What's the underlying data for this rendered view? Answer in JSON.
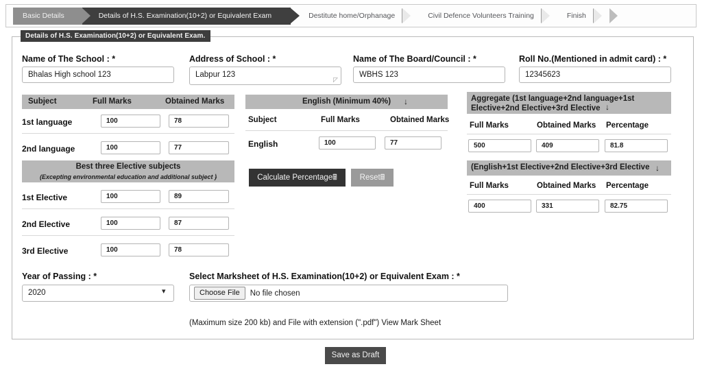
{
  "wizard": {
    "steps": [
      {
        "label": "Basic Details",
        "state": "done"
      },
      {
        "label": "Details of H.S. Examination(10+2) or Equivalent Exam",
        "state": "active"
      },
      {
        "label": "Destitute home/Orphanage",
        "state": "plain"
      },
      {
        "label": "Civil Defence Volunteers Training",
        "state": "plain"
      },
      {
        "label": "Finish",
        "state": "plain"
      }
    ]
  },
  "panel": {
    "legend": "Details of H.S. Examination(10+2) or Equivalent Exam."
  },
  "fields": {
    "school_name": {
      "label": "Name of The School : *",
      "value": "Bhalas High school 123"
    },
    "school_address": {
      "label": "Address of School : *",
      "value": "Labpur 123"
    },
    "board_name": {
      "label": "Name of The Board/Council : *",
      "value": "WBHS 123"
    },
    "roll_no": {
      "label": "Roll No.(Mentioned in admit card) : *",
      "value": "12345623"
    }
  },
  "language_table": {
    "headers": {
      "subject": "Subject",
      "full": "Full Marks",
      "obtained": "Obtained Marks"
    },
    "rows": [
      {
        "subject": "1st language",
        "full": "100",
        "obtained": "78"
      },
      {
        "subject": "2nd language",
        "full": "100",
        "obtained": "77"
      }
    ]
  },
  "elective_table": {
    "title": "Best three Elective subjects",
    "subtitle": "(Excepting environmental education and additional subject )",
    "arrow": "↓",
    "rows": [
      {
        "subject": "1st Elective",
        "full": "100",
        "obtained": "89"
      },
      {
        "subject": "2nd Elective",
        "full": "100",
        "obtained": "87"
      },
      {
        "subject": "3rd Elective",
        "full": "100",
        "obtained": "78"
      }
    ]
  },
  "english_table": {
    "title": "English (Minimum 40%)",
    "arrow": "↓",
    "headers": {
      "subject": "Subject",
      "full": "Full Marks",
      "obtained": "Obtained Marks"
    },
    "row": {
      "subject": "English",
      "full": "100",
      "obtained": "77"
    }
  },
  "actions": {
    "calculate_label": "Calculate Percentage",
    "calculate_icon": "὚9",
    "reset_label": "Reset",
    "reset_icon": "὚9",
    "save_label": "Save as Draft"
  },
  "aggregate": {
    "title": "Aggregate (1st language+2nd language+1st Elective+2nd Elective+3rd Elective",
    "arrow": "↓",
    "headers": {
      "full": "Full Marks",
      "obtained": "Obtained Marks",
      "percentage": "Percentage"
    },
    "full": "500",
    "obtained": "409",
    "percentage": "81.8"
  },
  "english_aggregate": {
    "title": "(English+1st Elective+2nd Elective+3rd Elective",
    "arrow": "↓",
    "headers": {
      "full": "Full Marks",
      "obtained": "Obtained Marks",
      "percentage": "Percentage"
    },
    "full": "400",
    "obtained": "331",
    "percentage": "82.75"
  },
  "year_of_passing": {
    "label": "Year of Passing : *",
    "value": "2020",
    "caret": "⌄"
  },
  "marksheet": {
    "label": "Select Marksheet of H.S. Examination(10+2) or Equivalent Exam : *",
    "choose_label": "Choose File",
    "status": "No file chosen",
    "hint": "(Maximum size 200 kb) and File with extension (\".pdf\") View Mark Sheet"
  },
  "colors": {
    "active_step": "#3f3f3f",
    "done_step": "#8e8e8e",
    "section_bar": "#b8b8b8",
    "primary_button": "#333333",
    "secondary_button": "#9a9a9a"
  }
}
